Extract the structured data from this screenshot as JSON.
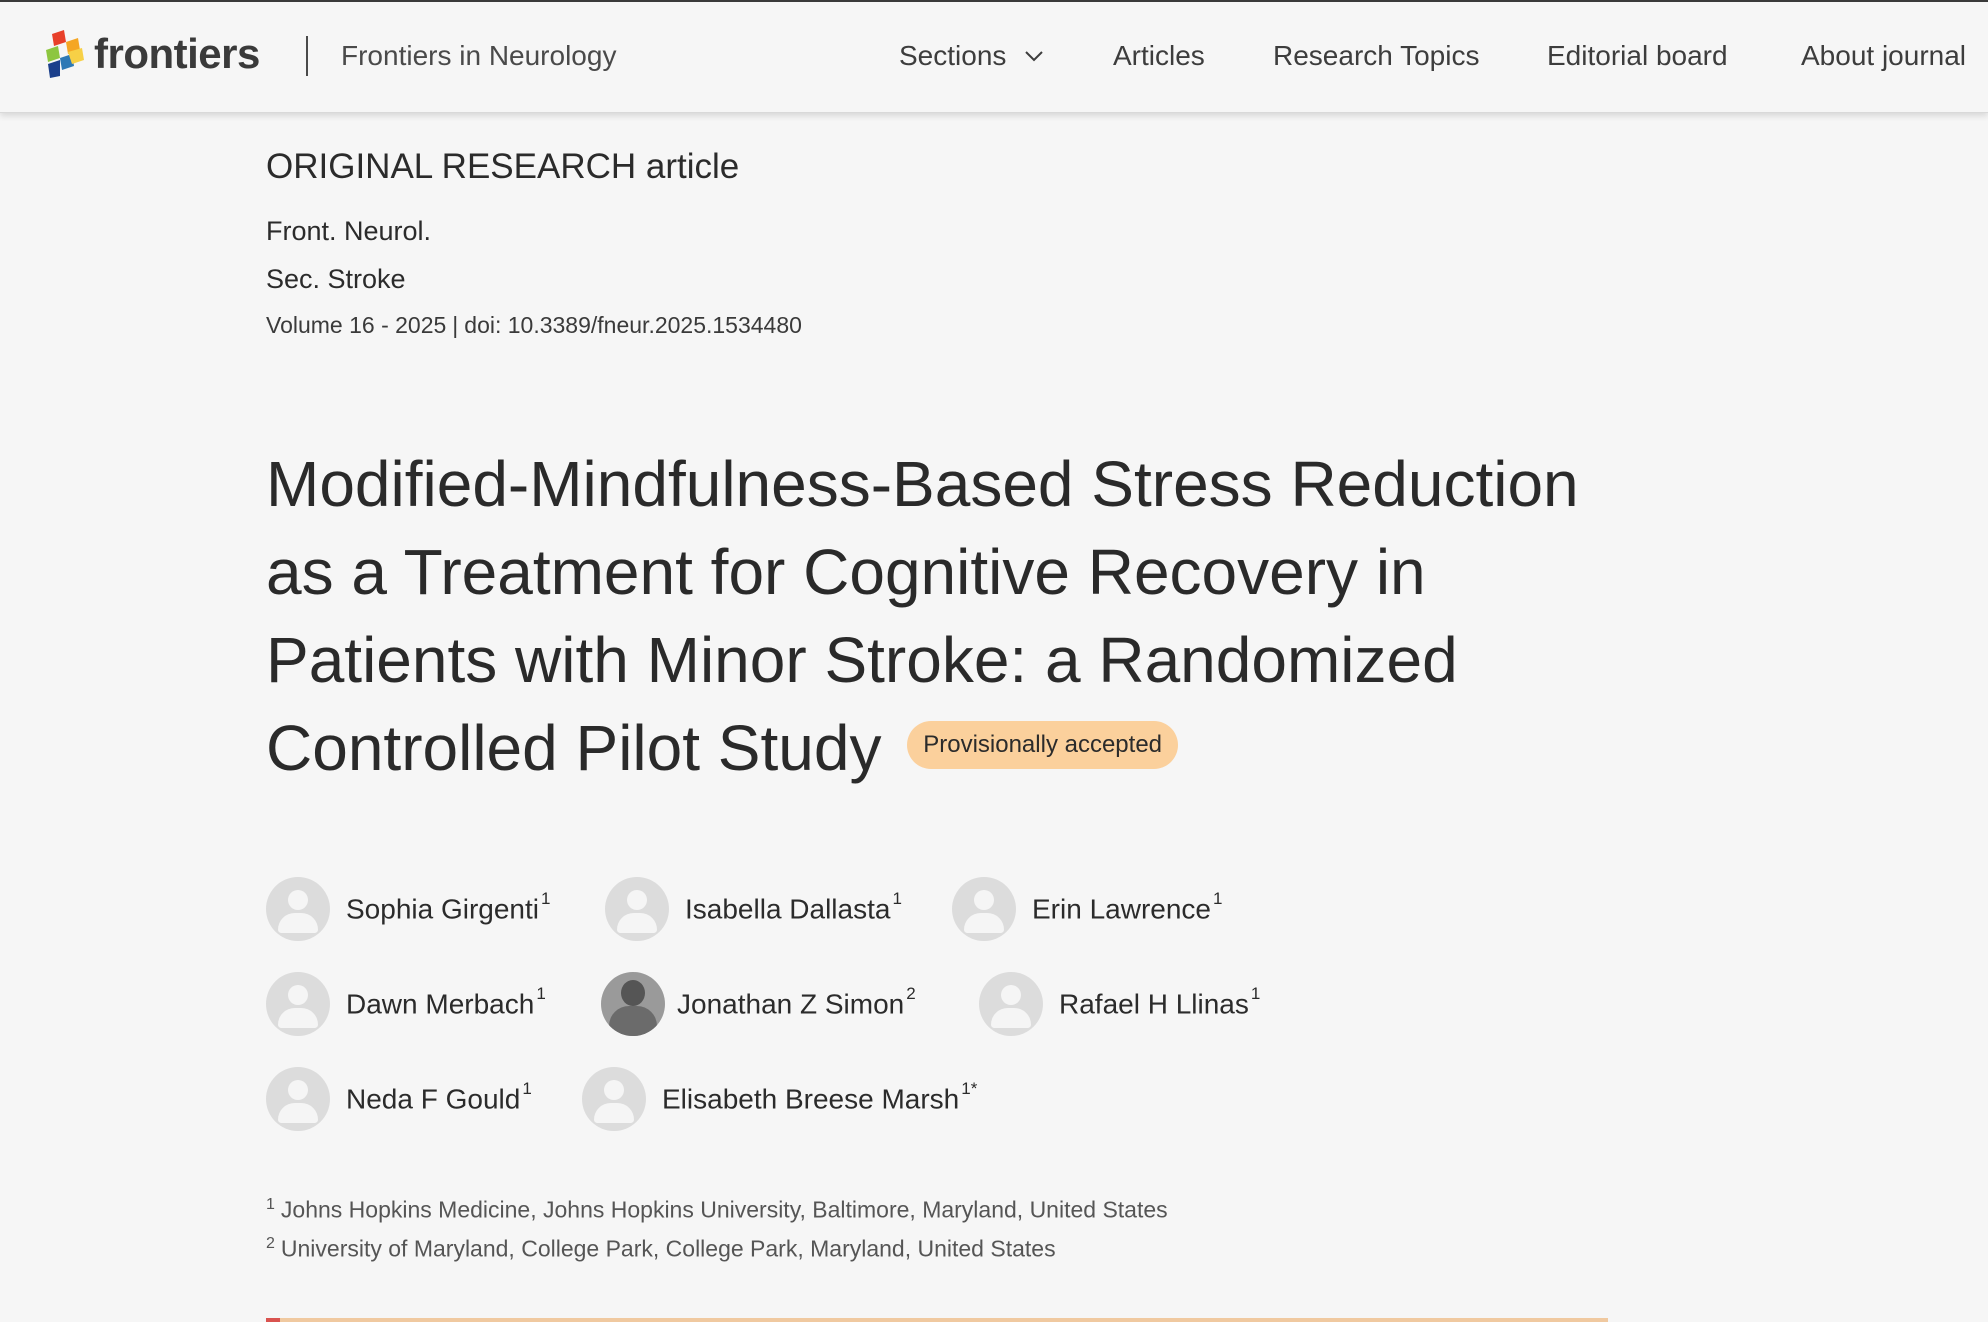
{
  "header": {
    "logo_text": "frontiers",
    "journal_name": "Frontiers in Neurology",
    "nav": {
      "sections": "Sections",
      "articles": "Articles",
      "research_topics": "Research Topics",
      "editorial_board": "Editorial board",
      "about": "About journal"
    }
  },
  "article": {
    "type": "ORIGINAL RESEARCH article",
    "journal_abbr": "Front. Neurol.",
    "section": "Sec. Stroke",
    "volume": "Volume 16 - 2025",
    "doi": "doi: 10.3389/fneur.2025.1534480",
    "title": "Modified-Mindfulness-Based Stress Reduction as a Treatment for Cognitive Recovery in Patients with Minor Stroke: a Randomized Controlled Pilot Study",
    "status_badge": "Provisionally accepted"
  },
  "authors": [
    {
      "name": "Sophia Girgenti",
      "sup": "1",
      "has_photo": false
    },
    {
      "name": "Isabella Dallasta",
      "sup": "1",
      "has_photo": false
    },
    {
      "name": "Erin Lawrence",
      "sup": "1",
      "has_photo": false
    },
    {
      "name": "Dawn Merbach",
      "sup": "1",
      "has_photo": false
    },
    {
      "name": "Jonathan Z Simon",
      "sup": "2",
      "has_photo": true
    },
    {
      "name": "Rafael H Llinas",
      "sup": "1",
      "has_photo": false
    },
    {
      "name": "Neda F Gould",
      "sup": "1",
      "has_photo": false
    },
    {
      "name": "Elisabeth Breese Marsh",
      "sup": "1*",
      "has_photo": false
    }
  ],
  "affiliations": [
    {
      "num": "1",
      "text": "Johns Hopkins Medicine, Johns Hopkins University, Baltimore, Maryland, United States"
    },
    {
      "num": "2",
      "text": "University of Maryland, College Park, College Park, Maryland, United States"
    }
  ],
  "colors": {
    "background": "#f6f6f6",
    "badge": "#fbd09c",
    "text": "#2b2b2b"
  }
}
